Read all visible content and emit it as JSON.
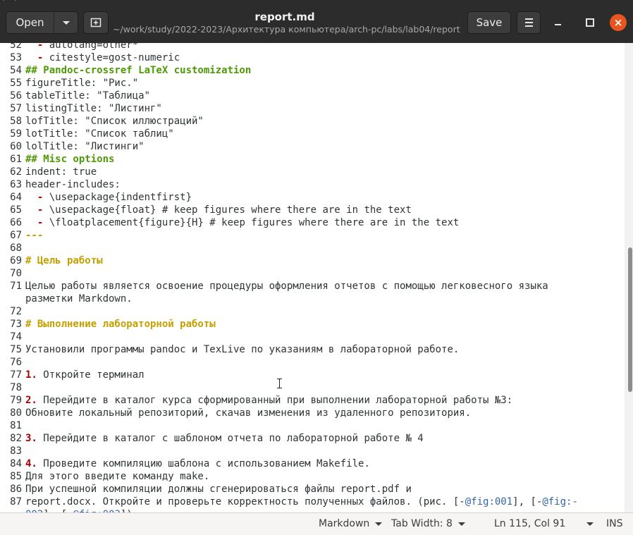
{
  "header": {
    "open_label": "Open",
    "save_label": "Save",
    "title": "report.md",
    "subtitle": "~/work/study/2022-2023/Архитектура компьютера/arch-pc/labs/lab04/report",
    "close_symbol": "×"
  },
  "icons": {
    "open_menu": "chevron-down-icon",
    "new_tab": "new-tab-icon",
    "menu": "hamburger-menu-icon",
    "minimize": "minimize-icon",
    "maximize": "maximize-icon",
    "close": "close-icon"
  },
  "colors": {
    "close_button": "#e95420",
    "heading": "#4e9a06",
    "list_marker": "#cc0000",
    "reference": "#3465a4"
  },
  "editor": {
    "lines": [
      {
        "n": "52",
        "parts": [
          {
            "t": "  "
          },
          {
            "t": "-",
            "c": "dash"
          },
          {
            "t": " autolang=other*"
          }
        ]
      },
      {
        "n": "53",
        "parts": [
          {
            "t": "  "
          },
          {
            "t": "-",
            "c": "dash"
          },
          {
            "t": " citestyle=gost-numeric"
          }
        ]
      },
      {
        "n": "54",
        "parts": [
          {
            "t": "## Pandoc-crossref LaTeX customization",
            "c": "hd"
          }
        ]
      },
      {
        "n": "55",
        "parts": [
          {
            "t": "figureTitle: \"Рис.\""
          }
        ]
      },
      {
        "n": "56",
        "parts": [
          {
            "t": "tableTitle: \"Таблица\""
          }
        ]
      },
      {
        "n": "57",
        "parts": [
          {
            "t": "listingTitle: \"Листинг\""
          }
        ]
      },
      {
        "n": "58",
        "parts": [
          {
            "t": "lofTitle: \"Список иллюстраций\""
          }
        ]
      },
      {
        "n": "59",
        "parts": [
          {
            "t": "lotTitle: \"Список таблиц\""
          }
        ]
      },
      {
        "n": "60",
        "parts": [
          {
            "t": "lolTitle: \"Листинги\""
          }
        ]
      },
      {
        "n": "61",
        "parts": [
          {
            "t": "## Misc options",
            "c": "hd"
          }
        ]
      },
      {
        "n": "62",
        "parts": [
          {
            "t": "indent: true"
          }
        ]
      },
      {
        "n": "63",
        "parts": [
          {
            "t": "header-includes:"
          }
        ]
      },
      {
        "n": "64",
        "parts": [
          {
            "t": "  "
          },
          {
            "t": "-",
            "c": "dash"
          },
          {
            "t": " \\usepackage{indentfirst}"
          }
        ]
      },
      {
        "n": "65",
        "parts": [
          {
            "t": "  "
          },
          {
            "t": "-",
            "c": "dash"
          },
          {
            "t": " \\usepackage{float} # keep figures where there are in the text"
          }
        ]
      },
      {
        "n": "66",
        "parts": [
          {
            "t": "  "
          },
          {
            "t": "-",
            "c": "dash"
          },
          {
            "t": " \\floatplacement{figure}{H} # keep figures where there are in the text"
          }
        ]
      },
      {
        "n": "67",
        "parts": [
          {
            "t": "---",
            "c": "sep"
          }
        ]
      },
      {
        "n": "68",
        "parts": [
          {
            "t": ""
          }
        ]
      },
      {
        "n": "69",
        "parts": [
          {
            "t": "# Цель работы",
            "c": "hd2"
          }
        ]
      },
      {
        "n": "70",
        "parts": [
          {
            "t": ""
          }
        ]
      },
      {
        "n": "71",
        "parts": [
          {
            "t": "Целью работы является освоение процедуры оформления отчетов с помощью легковесного языка"
          }
        ]
      },
      {
        "n": "",
        "parts": [
          {
            "t": "разметки Markdown."
          }
        ]
      },
      {
        "n": "72",
        "parts": [
          {
            "t": ""
          }
        ]
      },
      {
        "n": "73",
        "parts": [
          {
            "t": "# Выполнение лабораторной работы",
            "c": "hd2"
          }
        ]
      },
      {
        "n": "74",
        "parts": [
          {
            "t": ""
          }
        ]
      },
      {
        "n": "75",
        "parts": [
          {
            "t": "Установили программы pandoc и TexLive по указаниям в лабораторной работе."
          }
        ]
      },
      {
        "n": "76",
        "parts": [
          {
            "t": ""
          }
        ]
      },
      {
        "n": "77",
        "parts": [
          {
            "t": "1.",
            "c": "num"
          },
          {
            "t": " Откройте терминал"
          }
        ]
      },
      {
        "n": "78",
        "parts": [
          {
            "t": ""
          }
        ]
      },
      {
        "n": "79",
        "parts": [
          {
            "t": "2.",
            "c": "num"
          },
          {
            "t": " Перейдите в каталог курса сформированный при выполнении лабораторной работы №3:"
          }
        ]
      },
      {
        "n": "80",
        "parts": [
          {
            "t": "Обновите локальный репозиторий, скачав изменения из удаленного репозитория."
          }
        ]
      },
      {
        "n": "81",
        "parts": [
          {
            "t": ""
          }
        ]
      },
      {
        "n": "82",
        "parts": [
          {
            "t": "3.",
            "c": "num"
          },
          {
            "t": " Перейдите в каталог с шаблоном отчета по лабораторной работе № 4"
          }
        ]
      },
      {
        "n": "83",
        "parts": [
          {
            "t": ""
          }
        ]
      },
      {
        "n": "84",
        "parts": [
          {
            "t": "4.",
            "c": "num"
          },
          {
            "t": " Проведите компиляцию шаблона с использованием Makefile."
          }
        ]
      },
      {
        "n": "85",
        "parts": [
          {
            "t": "Для этого введите команду make."
          }
        ]
      },
      {
        "n": "86",
        "parts": [
          {
            "t": "При успешной компиляции должны сгенерироваться файлы report.pdf и"
          }
        ]
      },
      {
        "n": "87",
        "parts": [
          {
            "t": "report.docx. Откройте и проверьте корректность полученных файлов. (рис. [-"
          },
          {
            "t": "@fig:001",
            "c": "ref"
          },
          {
            "t": "], [-"
          },
          {
            "t": "@fig:-",
            "c": "ref"
          }
        ]
      },
      {
        "n": "",
        "parts": [
          {
            "t": "002",
            "c": "ref"
          },
          {
            "t": "], [-"
          },
          {
            "t": "@fig:003",
            "c": "ref"
          },
          {
            "t": "])"
          }
        ]
      }
    ]
  },
  "statusbar": {
    "language": "Markdown",
    "tab_width": "Tab Width: 8",
    "position": "Ln 115, Col 91",
    "mode": "INS"
  }
}
